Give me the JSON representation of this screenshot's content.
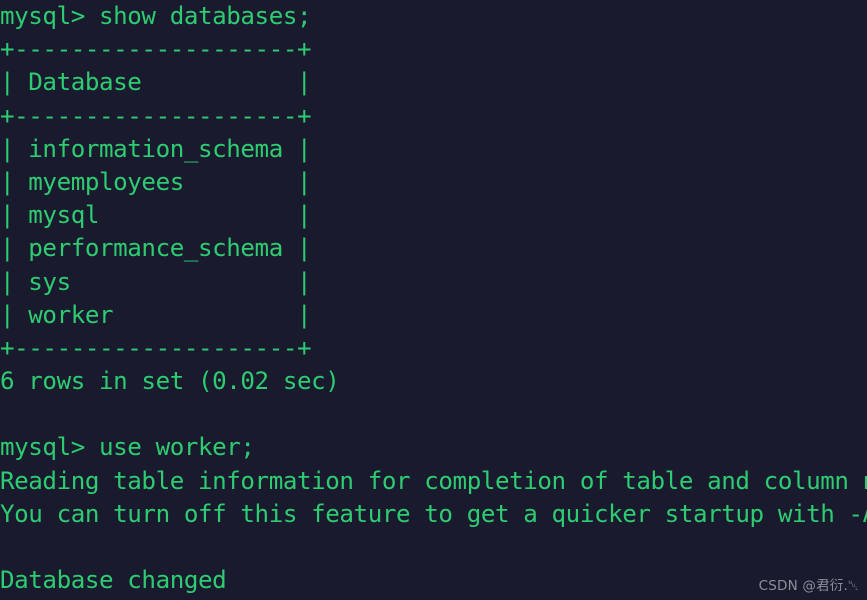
{
  "terminal": {
    "prompt": "mysql>",
    "colors": {
      "background": "#191a2e",
      "foreground": "#2ecc71",
      "watermark": "#8c9099"
    },
    "lines": [
      "mysql> show databases;",
      "+--------------------+",
      "| Database           |",
      "+--------------------+",
      "| information_schema |",
      "| myemployees        |",
      "| mysql              |",
      "| performance_schema |",
      "| sys                |",
      "| worker             |",
      "+--------------------+",
      "6 rows in set (0.02 sec)",
      "",
      "mysql> use worker;",
      "Reading table information for completion of table and column names",
      "You can turn off this feature to get a quicker startup with -A",
      "",
      "Database changed"
    ],
    "commands": [
      "show databases;",
      "use worker;"
    ],
    "result_table": {
      "header": "Database",
      "border": "+--------------------+",
      "rows": [
        "information_schema",
        "myemployees",
        "mysql",
        "performance_schema",
        "sys",
        "worker"
      ],
      "row_count": 6,
      "status": "6 rows in set (0.02 sec)"
    },
    "messages": [
      "Reading table information for completion of table and column names",
      "You can turn off this feature to get a quicker startup with -A",
      "Database changed"
    ]
  },
  "watermark": {
    "text": "CSDN @君衍.␀"
  }
}
